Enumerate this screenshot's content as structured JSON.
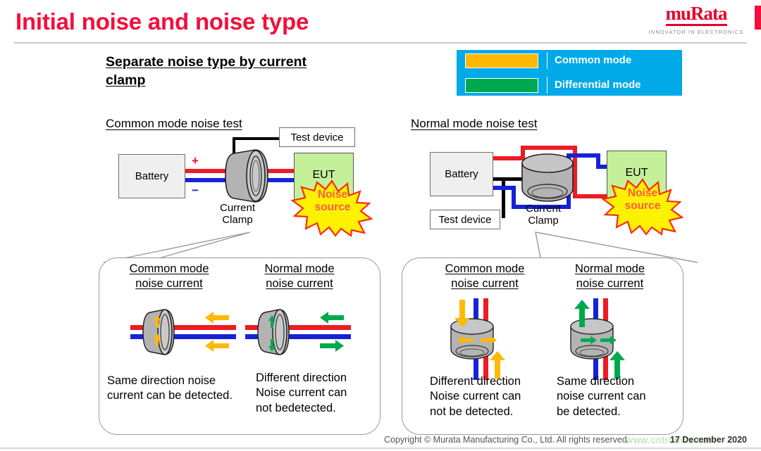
{
  "header": {
    "title": "Initial noise and noise type",
    "logo_text": "muRata",
    "logo_tagline": "INNOVATOR IN ELECTRONICS"
  },
  "section": {
    "heading_line1": " Separate noise type by current",
    "heading_line2": "clamp"
  },
  "legend": {
    "rows": [
      {
        "label": "Common mode",
        "color": "#FFB900"
      },
      {
        "label": "Differential mode",
        "color": "#00A94F"
      }
    ],
    "background": "#00A9E8"
  },
  "diagrams": [
    {
      "title": "Common mode noise test",
      "battery": "Battery",
      "test_device": "Test device",
      "eut": "EUT",
      "noise_source_line1": "Noise",
      "noise_source_line2": "source",
      "clamp_line1": "Current",
      "clamp_line2": "Clamp",
      "plus": "+",
      "minus": "−"
    },
    {
      "title": "Normal mode noise test",
      "battery": "Battery",
      "test_device": "Test device",
      "eut": "EUT",
      "noise_source_line1": "Noise",
      "noise_source_line2": "source",
      "clamp_line1": "Current",
      "clamp_line2": "Clamp"
    }
  ],
  "callouts": [
    {
      "id": "common-mode-test-callout",
      "panels": [
        {
          "head_line1": "Common mode ",
          "head_line2": "noise current",
          "text_line1": "Same direction noise",
          "text_line2": "current can be detected.",
          "arrow_color": "#FFB900"
        },
        {
          "head_line1": "Normal mode ",
          "head_line2": "noise current ",
          "text_line1": "Different direction",
          "text_line2": "Noise current can",
          "text_line3": "not bedetected.",
          "arrow_color": "#00A94F"
        }
      ]
    },
    {
      "id": "normal-mode-test-callout",
      "panels": [
        {
          "head_line1": "Common mode ",
          "head_line2": "noise current",
          "text_line1": "Different direction",
          "text_line2": "Noise current can",
          "text_line3": "not be detected.",
          "arrow_color": "#FFB900"
        },
        {
          "head_line1": "Normal mode ",
          "head_line2": "noise current ",
          "text_line1": "Same direction",
          "text_line2": "noise current can",
          "text_line3": "be detected.",
          "arrow_color": "#00A94F"
        }
      ]
    }
  ],
  "footer": {
    "copyright": "Copyright © Murata Manufacturing Co., Ltd. All rights reserved.",
    "date": "17 December 2020",
    "watermark": "www.cntronics.com"
  }
}
